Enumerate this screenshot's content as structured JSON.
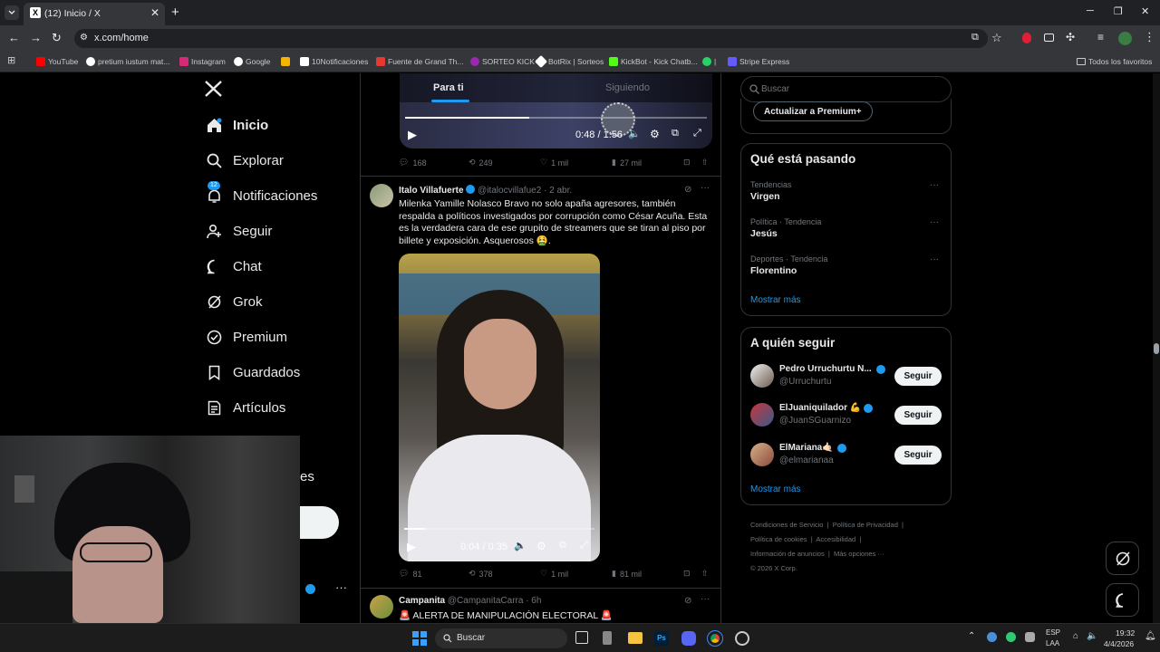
{
  "browser": {
    "tab_title": "(12) Inicio / X",
    "url": "x.com/home",
    "bookmarks": [
      "YouTube",
      "pretium iustum mat...",
      "Instagram",
      "Google",
      "10Notificaciones",
      "Fuente de Grand Th...",
      "SORTEO KICK",
      "BotRix | Sorteos",
      "KickBot - Kick Chatb...",
      "Stripe Express"
    ],
    "all_bookmarks": "Todos los favoritos"
  },
  "nav": {
    "logo": "X",
    "items": [
      "Inicio",
      "Explorar",
      "Notificaciones",
      "Seguir",
      "Chat",
      "Grok",
      "Premium",
      "Guardados",
      "Artículos"
    ],
    "notif_badge": "12",
    "partial_label": "es"
  },
  "feed": {
    "tabs": [
      "Para ti",
      "Siguiendo"
    ],
    "video1": {
      "time": "0:48 / 1:56",
      "progress": 0.41
    },
    "tweet0_stats": {
      "replies": "168",
      "reposts": "249",
      "likes": "1 mil",
      "views": "27 mil"
    },
    "tweet1": {
      "name": "Italo Villafuerte",
      "handle": "@italocvillafue2",
      "time": "· 2 abr.",
      "text": "Milenka Yamille Nolasco Bravo no solo apaña agresores, también respalda a políticos investigados por corrupción como César Acuña. Esta es la verdadera cara de ese grupito de streamers que se tiran al piso por billete y exposición. Asquerosos 🤮.",
      "video_time": "0:04 / 0:35",
      "video_progress": 0.11,
      "stats": {
        "replies": "81",
        "reposts": "378",
        "likes": "1 mil",
        "views": "81 mil"
      }
    },
    "tweet2": {
      "name": "Campanita",
      "handle": "@CampanitaCarra",
      "time": "· 6h",
      "text": "🚨 ALERTA DE MANIPULACIÓN ELECTORAL 🚨"
    }
  },
  "sidebar": {
    "search_placeholder": "Buscar",
    "premium_button": "Actualizar a Premium+",
    "trending_title": "Qué está pasando",
    "trends": [
      {
        "category": "Tendencias",
        "name": "Virgen"
      },
      {
        "category": "Política · Tendencia",
        "name": "Jesús"
      },
      {
        "category": "Deportes · Tendencia",
        "name": "Florentino"
      }
    ],
    "show_more": "Mostrar más",
    "follow_title": "A quién seguir",
    "follow": [
      {
        "name": "Pedro Urruchurtu N...",
        "handle": "@Urruchurtu",
        "button": "Seguir"
      },
      {
        "name": "ElJuaniquilador 💪",
        "handle": "@JuanSGuarnizo",
        "button": "Seguir"
      },
      {
        "name": "ElMariana🤙🏻",
        "handle": "@elmarianaa",
        "button": "Seguir"
      }
    ],
    "show_more2": "Mostrar más",
    "footer": [
      "Condiciones de Servicio",
      "Política de Privacidad",
      "Política de cookies",
      "Accesibilidad",
      "Información de anuncios",
      "Más opciones ···",
      "© 2026 X Corp."
    ]
  },
  "taskbar": {
    "search": "Buscar",
    "lang": "ESP",
    "lang2": "LAA",
    "time": "19:32",
    "date": "4/4/2026"
  },
  "colors": {
    "accent": "#1d9bf0",
    "bg": "#000000",
    "border": "#2f3336",
    "muted": "#71767b"
  }
}
